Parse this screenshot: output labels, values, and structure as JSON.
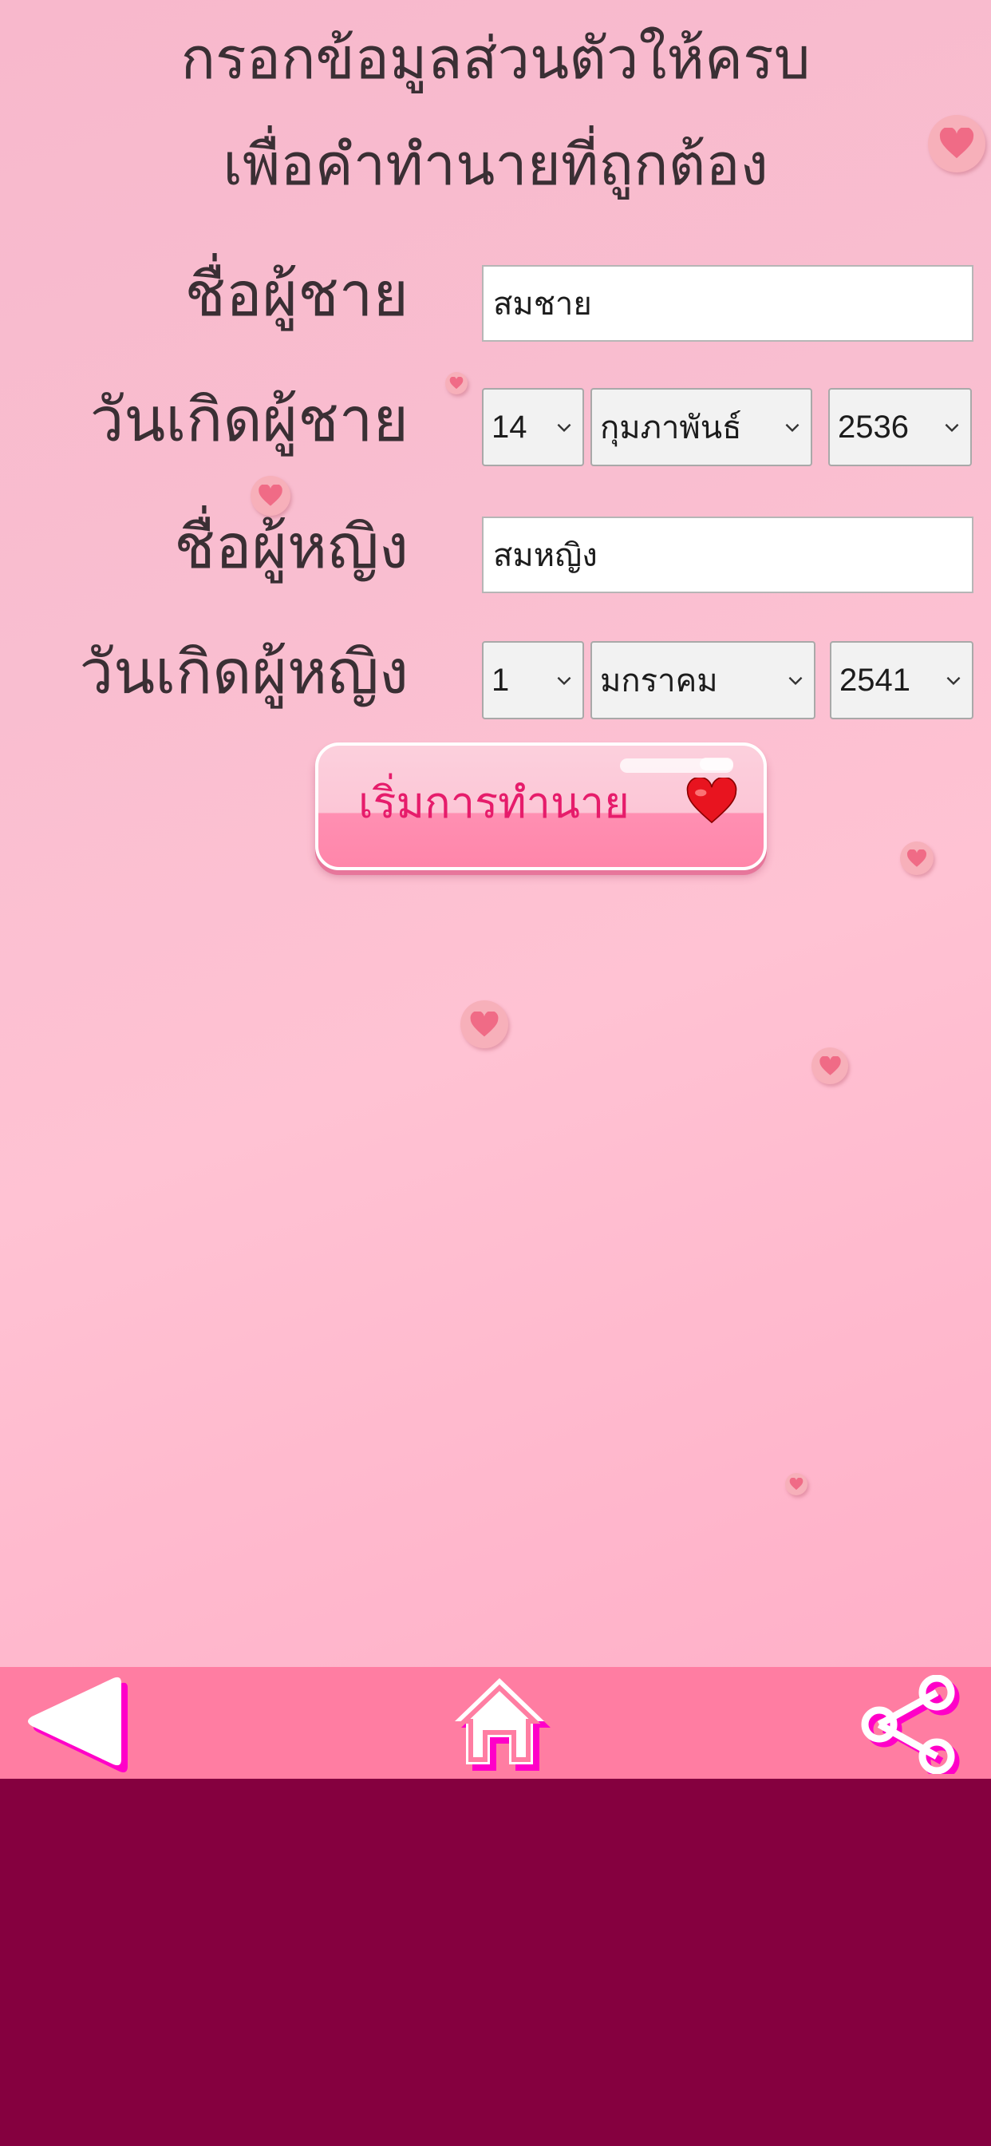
{
  "heading": {
    "line1": "กรอกข้อมูลส่วนตัวให้ครบ",
    "line2": "เพื่อคำทำนายที่ถูกต้อง"
  },
  "form": {
    "male_name_label": "ชื่อผู้ชาย",
    "male_name_value": "สมชาย",
    "male_birth_label": "วันเกิดผู้ชาย",
    "male_birth_day": "14",
    "male_birth_month": "กุมภาพันธ์",
    "male_birth_year": "2536",
    "female_name_label": "ชื่อผู้หญิง",
    "female_name_value": "สมหญิง",
    "female_birth_label": "วันเกิดผู้หญิง",
    "female_birth_day": "1",
    "female_birth_month": "มกราคม",
    "female_birth_year": "2541"
  },
  "start_button": {
    "label": "เริ่มการทำนาย",
    "icon": "heart-icon"
  },
  "navbar": {
    "back_icon": "back-triangle-icon",
    "home_icon": "home-icon",
    "share_icon": "share-icon"
  },
  "colors": {
    "background_top": "#f8b8cc",
    "navbar": "#ff7da2",
    "bottom_area": "#85003f",
    "button_text": "#e61c6b",
    "icon_shadow": "#ff00c8"
  }
}
